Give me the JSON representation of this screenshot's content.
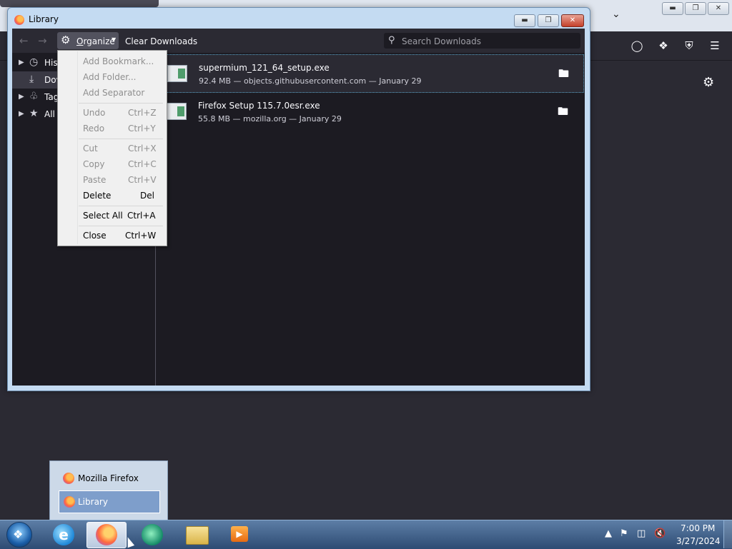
{
  "background_window": {
    "toolbar_icons": [
      "pocket-icon",
      "extensions-icon",
      "ublock-icon",
      "hamburger-menu-icon"
    ],
    "settings_icon": "gear-icon"
  },
  "library_window": {
    "title": "Library",
    "toolbar": {
      "organize_label": "Organize",
      "clear_label": "Clear Downloads",
      "search_placeholder": "Search Downloads"
    },
    "sidebar": {
      "items": [
        {
          "label": "Hist",
          "icon": "clock-icon"
        },
        {
          "label": "Dov",
          "icon": "download-icon"
        },
        {
          "label": "Tag",
          "icon": "tag-icon"
        },
        {
          "label": "All",
          "icon": "star-icon"
        }
      ]
    },
    "downloads": [
      {
        "name": "supermium_121_64_setup.exe",
        "meta": "92.4 MB — objects.githubusercontent.com — January 29"
      },
      {
        "name": "Firefox Setup 115.7.0esr.exe",
        "meta": "55.8 MB — mozilla.org — January 29"
      }
    ]
  },
  "organize_menu": {
    "items": [
      {
        "label": "Add Bookmark...",
        "shortcut": "",
        "enabled": false
      },
      {
        "label": "Add Folder...",
        "shortcut": "",
        "enabled": false
      },
      {
        "label": "Add Separator",
        "shortcut": "",
        "enabled": false
      },
      {
        "label": "Undo",
        "shortcut": "Ctrl+Z",
        "enabled": false
      },
      {
        "label": "Redo",
        "shortcut": "Ctrl+Y",
        "enabled": false
      },
      {
        "label": "Cut",
        "shortcut": "Ctrl+X",
        "enabled": false
      },
      {
        "label": "Copy",
        "shortcut": "Ctrl+C",
        "enabled": false
      },
      {
        "label": "Paste",
        "shortcut": "Ctrl+V",
        "enabled": false
      },
      {
        "label": "Delete",
        "shortcut": "Del",
        "enabled": true
      },
      {
        "label": "Select All",
        "shortcut": "Ctrl+A",
        "enabled": true
      },
      {
        "label": "Close",
        "shortcut": "Ctrl+W",
        "enabled": true
      }
    ]
  },
  "taskbar_popup": {
    "items": [
      {
        "label": "Mozilla Firefox",
        "selected": false
      },
      {
        "label": "Library",
        "selected": true
      }
    ]
  },
  "taskbar": {
    "apps": [
      "internet-explorer-icon",
      "firefox-icon",
      "supermium-icon",
      "file-explorer-icon",
      "media-player-icon"
    ],
    "clock_time": "7:00 PM",
    "clock_date": "3/27/2024"
  }
}
